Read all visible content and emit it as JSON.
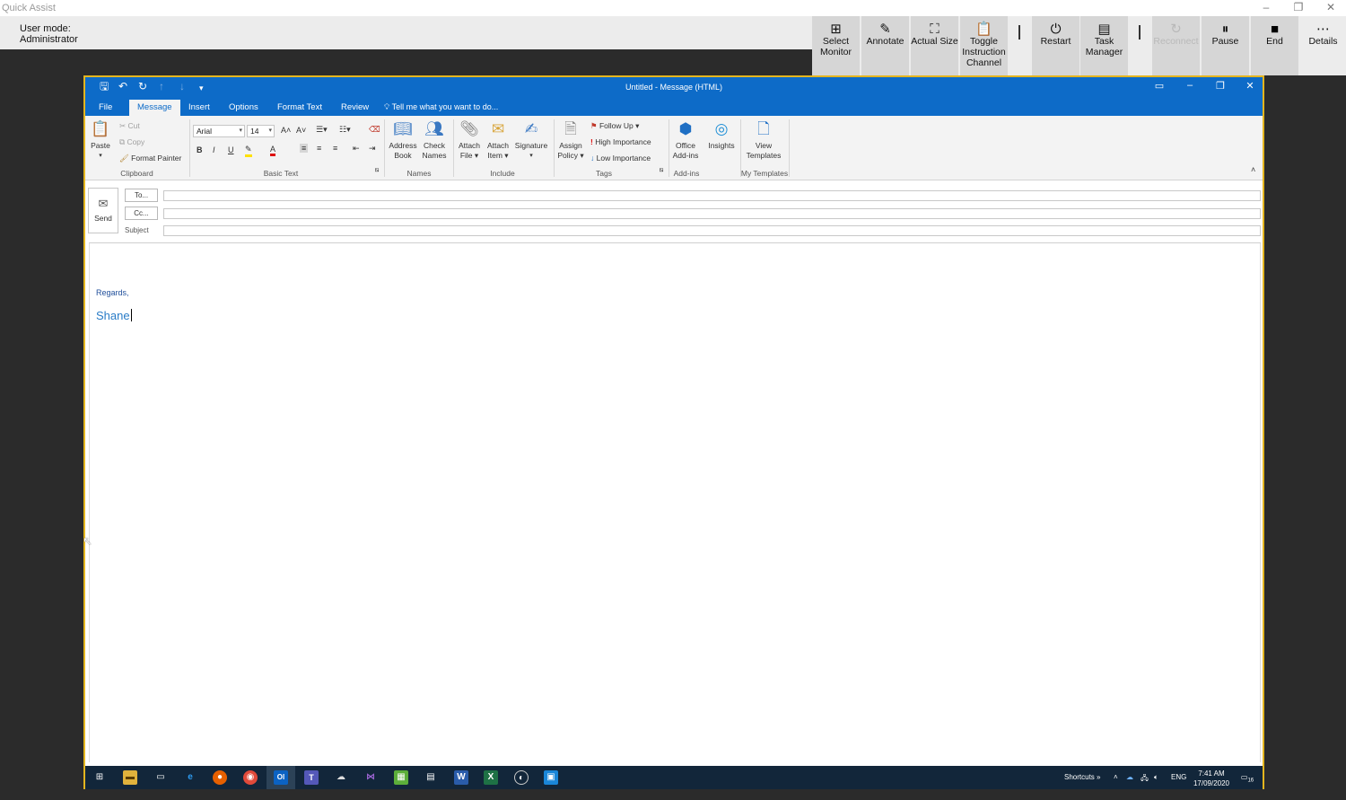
{
  "quick_assist": {
    "title": "Quick Assist",
    "window_controls": [
      "–",
      "❐",
      "✕"
    ],
    "user_mode_label": "User mode:",
    "user_mode_value": "Administrator",
    "toolbar": {
      "select_monitor": "Select Monitor",
      "annotate": "Annotate",
      "actual_size": "Actual Size",
      "toggle_channel": "Toggle Instruction Channel",
      "restart": "Restart",
      "task_manager": "Task Manager",
      "reconnect": "Reconnect",
      "pause": "Pause",
      "end": "End",
      "details": "Details"
    }
  },
  "outlook": {
    "window_title": "Untitled - Message (HTML)",
    "tabs": [
      "File",
      "Message",
      "Insert",
      "Options",
      "Format Text",
      "Review"
    ],
    "active_tab": "Message",
    "tell_me": "Tell me what you want to do...",
    "ribbon": {
      "clipboard": {
        "label": "Clipboard",
        "paste": "Paste",
        "cut": "Cut",
        "copy": "Copy",
        "format_painter": "Format Painter"
      },
      "basic_text": {
        "label": "Basic Text",
        "font": "Arial",
        "size": "14",
        "bold": "B",
        "italic": "I",
        "underline": "U"
      },
      "names": {
        "label": "Names",
        "address_book": "Address Book",
        "check_names": "Check Names"
      },
      "include": {
        "label": "Include",
        "attach_file": "Attach File",
        "attach_item": "Attach Item",
        "signature": "Signature"
      },
      "tags": {
        "label": "Tags",
        "assign_policy": "Assign Policy",
        "follow_up": "Follow Up",
        "high_importance": "High Importance",
        "low_importance": "Low Importance"
      },
      "add_ins": {
        "label": "Add-ins",
        "office_add_ins": "Office Add-ins",
        "insights": "Insights"
      },
      "my_templates": {
        "label": "My Templates",
        "view_templates": "View Templates"
      }
    },
    "header": {
      "send": "Send",
      "to": "To...",
      "cc": "Cc...",
      "subject": "Subject"
    },
    "body": {
      "regards": "Regards,",
      "signature_name": "Shane"
    }
  },
  "taskbar": {
    "shortcuts": "Shortcuts",
    "language": "ENG",
    "time": "7:41 AM",
    "date": "17/09/2020",
    "notification_count": "16"
  }
}
